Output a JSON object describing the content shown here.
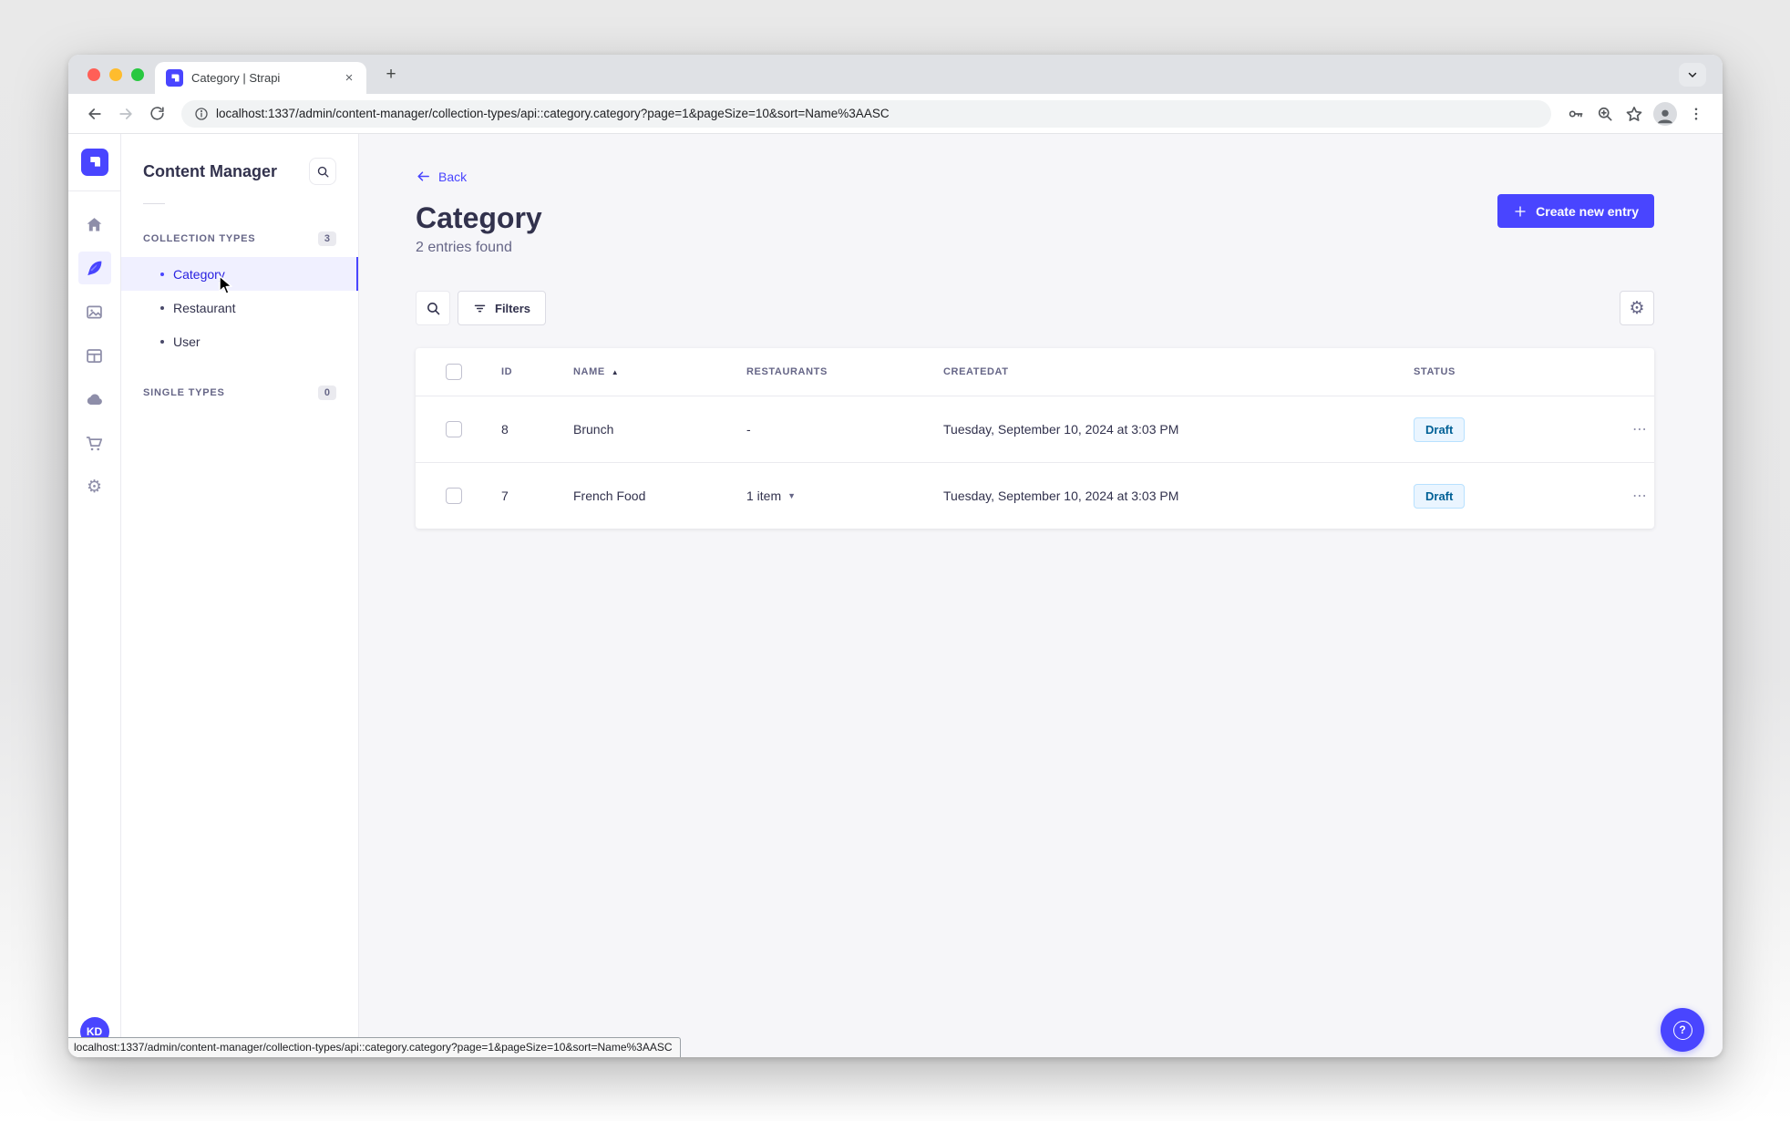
{
  "browser": {
    "tab_title": "Category | Strapi",
    "tab_close_glyph": "×",
    "new_tab_glyph": "+",
    "url": "localhost:1337/admin/content-manager/collection-types/api::category.category?page=1&pageSize=10&sort=Name%3AASC",
    "icons": [
      "back-arrow",
      "forward-arrow",
      "reload",
      "page-info",
      "password-key",
      "zoom-magnifier",
      "bookmark-star",
      "profile-avatar",
      "menu-dots",
      "tab-search-chevron"
    ]
  },
  "rail": {
    "icons": [
      "strapi-logo",
      "home",
      "content-manager-feather",
      "media-library-images",
      "content-type-builder-layout",
      "cloud",
      "marketplace-cart",
      "settings-gear"
    ],
    "active_icon": "content-manager-feather",
    "avatar_initials": "KD"
  },
  "sidebar": {
    "title": "Content Manager",
    "search_icon": "search-icon",
    "collection_types": {
      "label": "COLLECTION TYPES",
      "badge": "3",
      "items": [
        {
          "label": "Category",
          "active": true
        },
        {
          "label": "Restaurant",
          "active": false
        },
        {
          "label": "User",
          "active": false
        }
      ]
    },
    "single_types": {
      "label": "SINGLE TYPES",
      "badge": "0"
    }
  },
  "main": {
    "back_label": "Back",
    "title": "Category",
    "subtitle": "2 entries found",
    "create_button_label": "Create new entry",
    "filters_button_label": "Filters",
    "help_glyph": "?",
    "settings_gear_glyph": "⚙",
    "table": {
      "headers": {
        "id": "ID",
        "name": "NAME",
        "restaurants": "RESTAURANTS",
        "createdat": "CREATEDAT",
        "status": "STATUS"
      },
      "sort_asc_glyph": "▲",
      "dropdown_glyph": "▼",
      "row_actions_glyph": "⋯",
      "rows": [
        {
          "id": "8",
          "name": "Brunch",
          "restaurants": "-",
          "createdat": "Tuesday, September 10, 2024 at 3:03 PM",
          "status": "Draft"
        },
        {
          "id": "7",
          "name": "French Food",
          "restaurants": "1 item",
          "createdat": "Tuesday, September 10, 2024 at 3:03 PM",
          "status": "Draft"
        }
      ]
    }
  },
  "status_bar": {
    "url": "localhost:1337/admin/content-manager/collection-types/api::category.category?page=1&pageSize=10&sort=Name%3AASC"
  },
  "colors": {
    "primary": "#4945ff",
    "active_bg": "#f0f0ff",
    "active_text": "#271fe0",
    "draft_bg": "#eaf5ff",
    "draft_border": "#b8e1ff",
    "draft_text": "#006096",
    "main_bg": "#f6f6f9",
    "border": "#eaeaef"
  }
}
